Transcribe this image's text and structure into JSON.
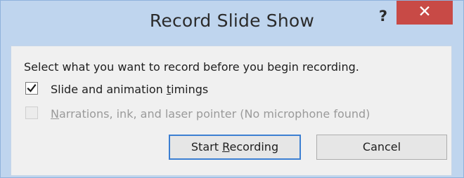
{
  "dialog": {
    "title": "Record Slide Show",
    "help_label": "?",
    "close_label": "✕",
    "prompt": "Select what you want to record before you begin recording.",
    "options": [
      {
        "label_pre": "Slide and animation ",
        "label_underlined": "t",
        "label_post": "imings",
        "checked": true,
        "enabled": true
      },
      {
        "label_pre": "",
        "label_underlined": "N",
        "label_post": "arrations, ink, and laser pointer (No microphone found)",
        "checked": false,
        "enabled": false
      }
    ],
    "start_button": {
      "label_pre": "Start ",
      "label_underlined": "R",
      "label_post": "ecording"
    },
    "cancel_label": "Cancel"
  },
  "colors": {
    "frame": "#bfd5ee",
    "close_button": "#c84a46",
    "content_bg": "#f0f0f0",
    "focus_border": "#3c7fd2"
  }
}
